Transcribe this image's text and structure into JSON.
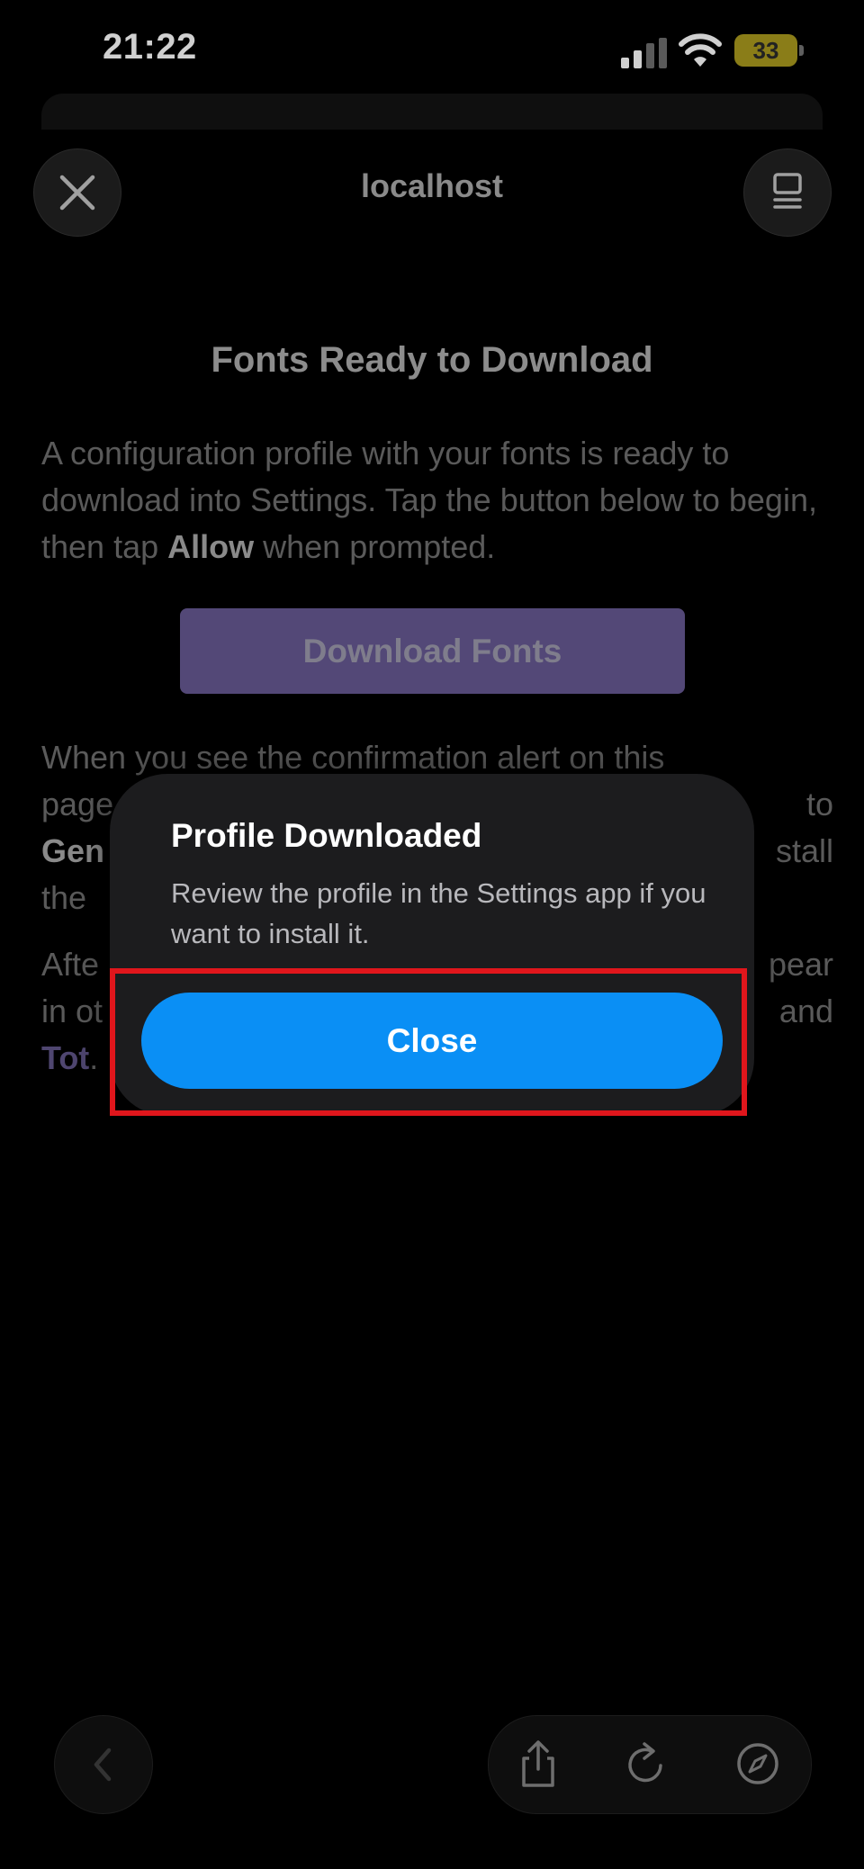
{
  "status_bar": {
    "time": "21:22",
    "battery": "33"
  },
  "header": {
    "url": "localhost"
  },
  "page": {
    "title": "Fonts Ready to Download",
    "para1_a": "A configuration profile with your fonts is ready to download into Settings. Tap the button below to begin, then tap ",
    "para1_bold": "Allow",
    "para1_b": " when prompted.",
    "download_button": "Download Fonts",
    "para2_l1_a": "When you see the confirmation alert on this",
    "para2_l2_a": "page",
    "para2_l2_b": "to",
    "para2_l3_a": "Gen",
    "para2_l3_b": "stall",
    "para2_l4_a": "the ",
    "para3_l1_a": "Afte",
    "para3_l1_b": "pear",
    "para3_l2_a": "in ot",
    "para3_l2_b": "and",
    "para3_l3_a": "Tot",
    "para3_l3_b": "."
  },
  "modal": {
    "title": "Profile Downloaded",
    "message": "Review the profile in the Settings app if you want to install it.",
    "close_label": "Close"
  },
  "colors": {
    "accent": "#0a8ff5",
    "highlight": "#e0161c"
  }
}
